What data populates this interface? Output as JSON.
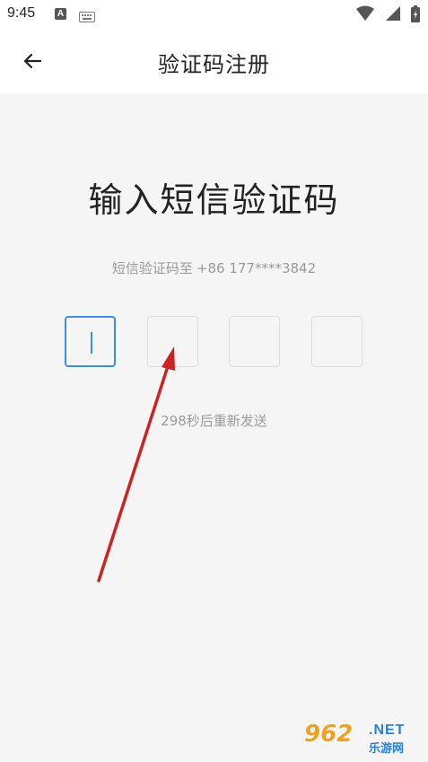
{
  "status_bar": {
    "time": "9:45",
    "notification_letter": "A",
    "icons": [
      "keyboard-icon",
      "wifi-icon",
      "signal-icon",
      "battery-icon"
    ]
  },
  "app_bar": {
    "title": "验证码注册",
    "back_icon": "arrow-left-icon"
  },
  "main": {
    "heading": "输入短信验证码",
    "sent_to_label": "短信验证码至",
    "phone": "+86 177****3842",
    "code_boxes": [
      {
        "value": "",
        "active": true
      },
      {
        "value": "",
        "active": false
      },
      {
        "value": "",
        "active": false
      },
      {
        "value": "",
        "active": false
      }
    ],
    "resend_text": "298秒后重新发送"
  },
  "overlay": {
    "arrow_color": "#cc2222"
  },
  "watermark": {
    "logo_text": "962",
    "net_text": ".NET",
    "sub_text": "乐游网"
  },
  "colors": {
    "accent": "#3d8ee0",
    "background": "#f5f5f5",
    "muted_text": "#999999"
  }
}
